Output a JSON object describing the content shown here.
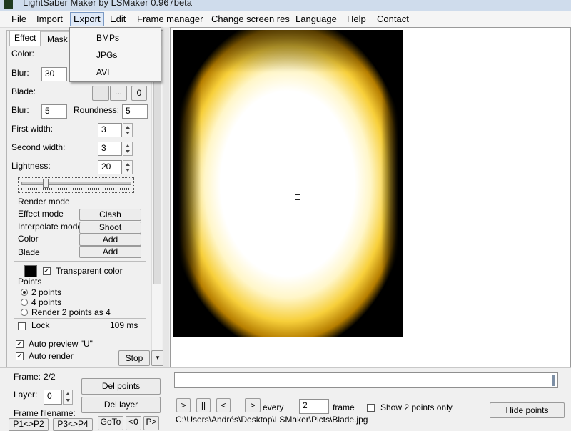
{
  "window": {
    "title": "LightSaber Maker by LSMaker 0.967beta"
  },
  "menu": {
    "items": [
      "File",
      "Import",
      "Export",
      "Edit",
      "Frame manager",
      "Change screen res",
      "Language",
      "Help",
      "Contact"
    ],
    "active": "Export"
  },
  "export_menu": {
    "items": [
      "BMPs",
      "JPGs",
      "AVI"
    ]
  },
  "tabs": {
    "effect": "Effect",
    "mask": "Mask"
  },
  "panel": {
    "color_label": "Color:",
    "blur_label": "Blur:",
    "blur_value": "30",
    "blade_label": "Blade:",
    "blade_browse": "...",
    "blade_zero": "0",
    "blur2_label": "Blur:",
    "blur2_value": "5",
    "roundness_label": "Roundness:",
    "roundness_value": "5",
    "first_width_label": "First width:",
    "first_width_value": "3",
    "second_width_label": "Second width:",
    "second_width_value": "3",
    "lightness_label": "Lightness:",
    "lightness_value": "20"
  },
  "render_mode": {
    "title": "Render mode",
    "rows": [
      {
        "label": "Effect mode",
        "value": "Clash"
      },
      {
        "label": "Interpolate mode",
        "value": "Shoot"
      },
      {
        "label": "Color",
        "value": "Add"
      },
      {
        "label": "Blade",
        "value": "Add"
      }
    ]
  },
  "transparent": {
    "label": "Transparent color",
    "checked": true,
    "color": "#000000"
  },
  "points": {
    "title": "Points",
    "options": [
      "2 points",
      "4 points",
      "Render 2 points as 4"
    ],
    "selected": 0
  },
  "lock": {
    "label": "Lock",
    "checked": false,
    "time": "109 ms"
  },
  "auto_preview": {
    "label": "Auto preview \"U\"",
    "checked": true
  },
  "auto_render": {
    "label": "Auto render",
    "checked": true
  },
  "stop_button": "Stop",
  "frame": {
    "frame_label": "Frame:",
    "frame_value": "2/2",
    "layer_label": "Layer:",
    "layer_value": "0",
    "del_points": "Del points",
    "del_layer": "Del layer",
    "filename_label": "Frame filename:",
    "p1p2": "P1<>P2",
    "p3p4": "P3<>P4",
    "goto": "GoTo",
    "prev0": "<0",
    "next_p": "P>"
  },
  "playback": {
    "play": ">",
    "pause": "||",
    "back": "<",
    "forward": ">",
    "every_label": "every",
    "every_value": "2",
    "frame_label": "frame",
    "show2_label": "Show 2 points only",
    "show2_checked": false,
    "hide_points": "Hide points",
    "filepath": "C:\\Users\\Andrés\\Desktop\\LSMaker\\Picts\\Blade.jpg"
  }
}
